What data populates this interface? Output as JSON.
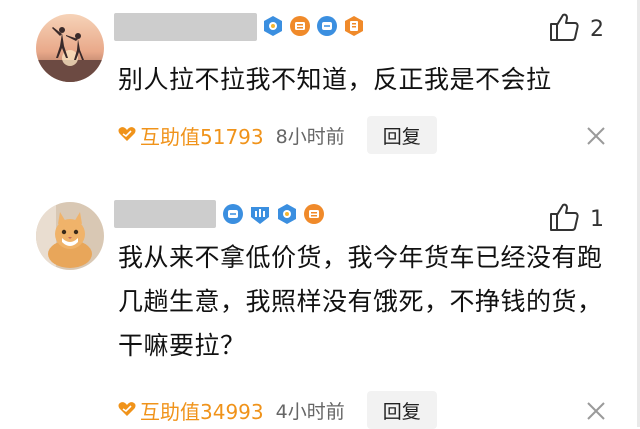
{
  "comments": [
    {
      "username": "",
      "likes": "2",
      "text": "别人拉不拉我不知道，反正我是不会拉",
      "help_value": "互助值51793",
      "time": "8小时前",
      "reply_label": "回复"
    },
    {
      "username": "",
      "likes": "1",
      "text": "我从来不拿低价货，我今年货车已经没有跑几趟生意，我照样没有饿死，不挣钱的货，干嘛要拉？",
      "help_value": "互助值34993",
      "time": "4小时前",
      "reply_label": "回复"
    }
  ],
  "colors": {
    "accent": "#f0931a",
    "badge_blue": "#3b8fe0",
    "badge_orange": "#f08a2a",
    "reply_bg": "#f2f2f2"
  },
  "icons": [
    "thumb-up-icon",
    "close-icon",
    "heart-icon",
    "level-badge-icon"
  ]
}
